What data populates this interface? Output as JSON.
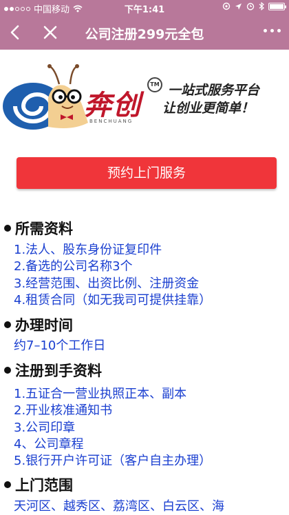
{
  "status_bar": {
    "carrier": "中国移动",
    "time": "下午1:41"
  },
  "nav": {
    "title": "公司注册299元全包"
  },
  "banner": {
    "brand": "奔创",
    "trademark": "TM",
    "brand_pinyin": "BENCHUANG",
    "slogan_line1": "一站式服务平台",
    "slogan_line2": "让创业更简单！"
  },
  "cta": {
    "label": "预约上门服务"
  },
  "sections": [
    {
      "title": "所需资料",
      "items": [
        "1.法人、股东身份证复印件",
        "2.备选的公司名称3个",
        "3.经营范围、出资比例、注册资金",
        "4.租赁合同（如无我司可提供挂靠）"
      ]
    },
    {
      "title": "办理时间",
      "items": [
        "约7–10个工作日"
      ]
    },
    {
      "title": "注册到手资料",
      "items": [
        "1.五证合一营业执照正本、副本",
        "2.开业核准通知书",
        "3.公司印章",
        "4、公司章程",
        "5.银行开户许可证（客户自主办理）"
      ]
    },
    {
      "title": "上门范围",
      "items": [
        "天河区、越秀区、荔湾区、白云区、海"
      ]
    }
  ]
}
